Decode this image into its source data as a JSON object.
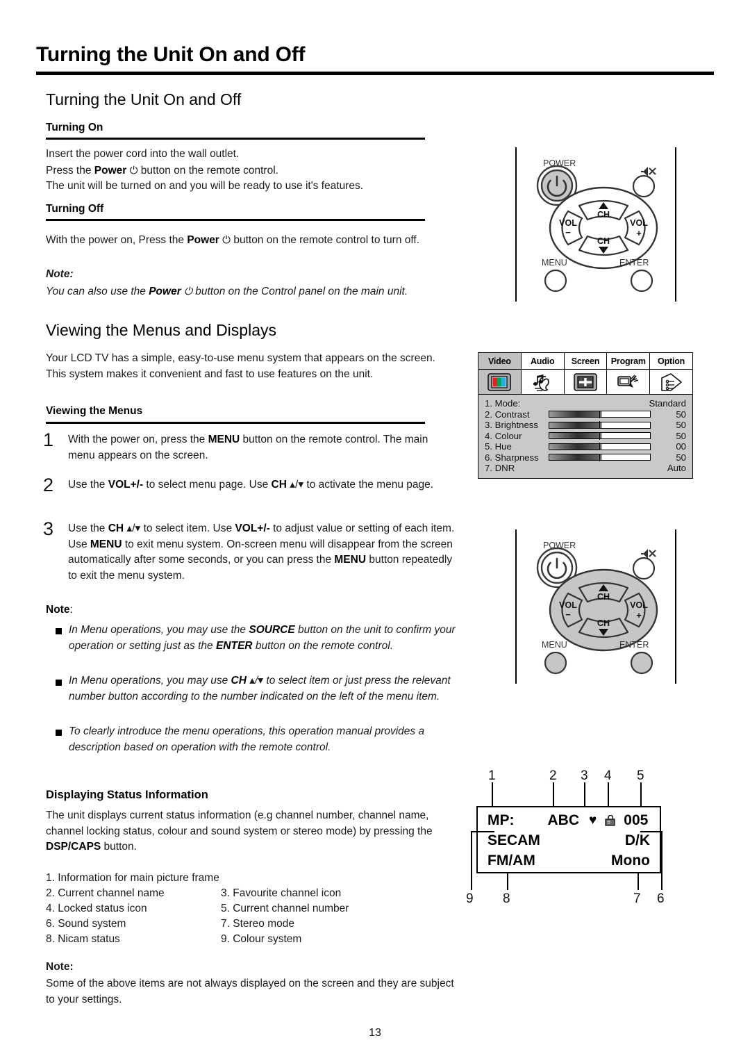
{
  "header": {
    "title": "Turning the Unit On and Off"
  },
  "section1": {
    "heading": "Turning the Unit On and Off",
    "turning_on": {
      "heading": "Turning On",
      "lines": [
        "Insert the power cord into the wall outlet.",
        "Press the Power ⏻ button on the remote control.",
        "The unit will be turned on and you will be ready to use it's features."
      ]
    },
    "turning_off": {
      "heading": "Turning Off",
      "body": "With the power on, Press the Power ⏻ button on the remote control to turn off.",
      "note_label": "Note:",
      "note_body": "You can also use the Power ⏻ button on the Control panel on the main unit."
    }
  },
  "section2": {
    "heading": "Viewing the Menus and Displays",
    "intro": "Your LCD TV has a simple, easy-to-use menu system that appears on the screen. This system makes it convenient and fast to use features on the unit.",
    "viewing_menus_heading": "Viewing the Menus",
    "steps": [
      {
        "num": "1",
        "text": "With the power on, press the MENU button on the remote control. The main menu appears on the screen."
      },
      {
        "num": "2",
        "text": "Use the VOL+/- to select menu page. Use CH ▴/▾ to activate the menu page."
      },
      {
        "num": "3",
        "text": "Use the CH ▴/▾ to select item. Use VOL+/- to adjust value or setting of each item. Use MENU to exit menu system. On-screen menu will disappear from the screen automatically after some seconds, or you can press the MENU button repeatedly to exit the menu system."
      }
    ],
    "note_label": "Note",
    "note_colon": ":",
    "notes": [
      "In Menu operations, you may use the SOURCE button on the unit to confirm your operation or setting just as the ENTER button on the remote control.",
      "In Menu operations, you may use CH ▴/▾ to select item or just press the relevant number button according to the number indicated on the left of the menu item.",
      "To clearly introduce the menu operations, this operation manual provides a description based on operation with the remote control."
    ]
  },
  "section3": {
    "heading": "Displaying Status Information",
    "body": "The unit displays current status information (e.g channel number, channel name, channel locking status, colour and sound system or stereo mode) by pressing the DSP/CAPS button.",
    "legend": [
      "1. Information for main picture frame",
      "2. Current channel name",
      "3. Favourite channel icon",
      "4. Locked status icon",
      "5. Current channel number",
      "6. Sound system",
      "7. Stereo mode",
      "8. Nicam status",
      "9. Colour system"
    ],
    "note_label": "Note:",
    "note_body": "Some of the above items are not always displayed on the screen and they are subject to your settings."
  },
  "remote": {
    "power_label": "POWER",
    "mute_label": "mute-icon",
    "ch_up_label": "CH",
    "ch_down_label": "CH",
    "vol_minus_label": "VOL",
    "vol_minus_sign": "−",
    "vol_plus_label": "VOL",
    "vol_plus_sign": "+",
    "menu_label": "MENU",
    "enter_label": "ENTER"
  },
  "osd": {
    "tabs": [
      {
        "label": "Video",
        "icon": "colour-bars-icon",
        "selected": true
      },
      {
        "label": "Audio",
        "icon": "music-ear-icon",
        "selected": false
      },
      {
        "label": "Screen",
        "icon": "screen-plus-icon",
        "selected": false
      },
      {
        "label": "Program",
        "icon": "antenna-icon",
        "selected": false
      },
      {
        "label": "Option",
        "icon": "options-list-icon",
        "selected": false
      }
    ],
    "rows": [
      {
        "label": "1. Mode:",
        "bar": false,
        "value": "Standard"
      },
      {
        "label": "2. Contrast",
        "bar": true,
        "value": "50"
      },
      {
        "label": "3. Brightness",
        "bar": true,
        "value": "50"
      },
      {
        "label": "4. Colour",
        "bar": true,
        "value": "50"
      },
      {
        "label": "5. Hue",
        "bar": true,
        "value": "00"
      },
      {
        "label": "6. Sharpness",
        "bar": true,
        "value": "50"
      },
      {
        "label": "7. DNR",
        "bar": false,
        "value": "Auto"
      }
    ],
    "colors": {
      "red": "#ee1c24",
      "green": "#00a551",
      "blue": "#29abe2",
      "panel": "#c9c9c9"
    }
  },
  "status_display": {
    "line1_left": "MP:",
    "line1_name": "ABC",
    "line1_fav": "♥",
    "line1_lock": "lock-icon",
    "line1_channel": "005",
    "line2_left": "SECAM",
    "line2_right": "D/K",
    "line3_left": "FM/AM",
    "line3_right": "Mono",
    "callouts_top": [
      "1",
      "2",
      "3",
      "4",
      "5"
    ],
    "callouts_bottom": [
      "9",
      "8",
      "7",
      "6"
    ]
  },
  "footer": {
    "page_number": "13"
  }
}
